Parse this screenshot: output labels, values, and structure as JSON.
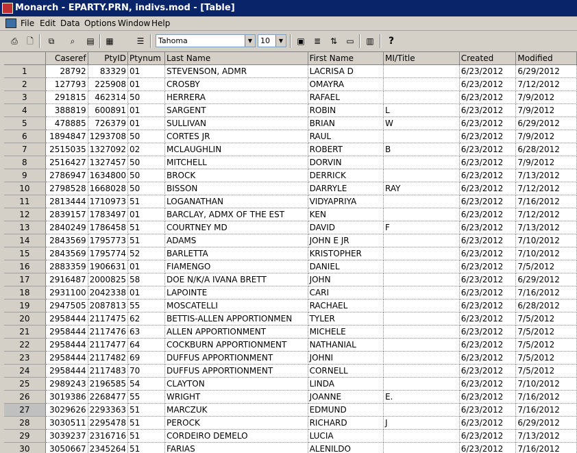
{
  "window": {
    "title": "Monarch - EPARTY.PRN, indivs.mod - [Table]"
  },
  "menu": [
    "File",
    "Edit",
    "Data",
    "Options",
    "Window",
    "Help"
  ],
  "toolbar": {
    "font": "Tahoma",
    "size": "10",
    "buttons_left": [
      {
        "name": "print-button",
        "glyph": "⎙"
      },
      {
        "name": "print-preview-button",
        "glyph": "🗋"
      },
      {
        "name": "copy-button",
        "glyph": "⧉"
      },
      {
        "name": "find-button",
        "glyph": "⌕"
      },
      {
        "name": "export-button",
        "glyph": "▤"
      },
      {
        "name": "grid-button",
        "glyph": "▦"
      },
      {
        "name": "sort-button",
        "glyph": "☰"
      }
    ],
    "buttons_right": [
      {
        "name": "calculator-button",
        "glyph": "▣"
      },
      {
        "name": "field-list-button",
        "glyph": "≣"
      },
      {
        "name": "sort-order-button",
        "glyph": "⇅"
      },
      {
        "name": "note-button",
        "glyph": "▭"
      },
      {
        "name": "summary-button",
        "glyph": "▥"
      },
      {
        "name": "help-button",
        "glyph": "?"
      }
    ]
  },
  "table": {
    "headers": [
      "",
      "Caseref",
      "PtyID",
      "Ptynum",
      "Last Name",
      "First Name",
      "MI/Title",
      "Created",
      "Modified"
    ],
    "rows": [
      [
        "1",
        "28792",
        "83329",
        "01",
        "STEVENSON, ADMR",
        "LACRISA D",
        "",
        "6/23/2012",
        "6/29/2012"
      ],
      [
        "2",
        "127793",
        "225908",
        "01",
        "CROSBY",
        "OMAYRA",
        "",
        "6/23/2012",
        "7/12/2012"
      ],
      [
        "3",
        "291815",
        "462314",
        "50",
        "HERRERA",
        "RAFAEL",
        "",
        "6/23/2012",
        "7/9/2012"
      ],
      [
        "4",
        "388819",
        "600891",
        "01",
        "SARGENT",
        "ROBIN",
        "L",
        "6/23/2012",
        "7/9/2012"
      ],
      [
        "5",
        "478885",
        "726379",
        "01",
        "SULLIVAN",
        "BRIAN",
        "W",
        "6/23/2012",
        "6/29/2012"
      ],
      [
        "6",
        "1894847",
        "1293708",
        "50",
        "CORTES JR",
        "RAUL",
        "",
        "6/23/2012",
        "7/9/2012"
      ],
      [
        "7",
        "2515035",
        "1327092",
        "02",
        "MCLAUGHLIN",
        "ROBERT",
        "B",
        "6/23/2012",
        "6/28/2012"
      ],
      [
        "8",
        "2516427",
        "1327457",
        "50",
        "MITCHELL",
        "DORVIN",
        "",
        "6/23/2012",
        "7/9/2012"
      ],
      [
        "9",
        "2786947",
        "1634800",
        "50",
        "BROCK",
        "DERRICK",
        "",
        "6/23/2012",
        "7/13/2012"
      ],
      [
        "10",
        "2798528",
        "1668028",
        "50",
        "BISSON",
        "DARRYLE",
        "RAY",
        "6/23/2012",
        "7/12/2012"
      ],
      [
        "11",
        "2813444",
        "1710973",
        "51",
        "LOGANATHAN",
        "VIDYAPRIYA",
        "",
        "6/23/2012",
        "7/16/2012"
      ],
      [
        "12",
        "2839157",
        "1783497",
        "01",
        "BARCLAY, ADMX OF THE EST",
        "KEN",
        "",
        "6/23/2012",
        "7/12/2012"
      ],
      [
        "13",
        "2840249",
        "1786458",
        "51",
        "COURTNEY MD",
        "DAVID",
        "F",
        "6/23/2012",
        "7/13/2012"
      ],
      [
        "14",
        "2843569",
        "1795773",
        "51",
        "ADAMS",
        "JOHN E JR",
        "",
        "6/23/2012",
        "7/10/2012"
      ],
      [
        "15",
        "2843569",
        "1795774",
        "52",
        "BARLETTA",
        "KRISTOPHER",
        "",
        "6/23/2012",
        "7/10/2012"
      ],
      [
        "16",
        "2883359",
        "1906631",
        "01",
        "FIAMENGO",
        "DANIEL",
        "",
        "6/23/2012",
        "7/5/2012"
      ],
      [
        "17",
        "2916487",
        "2000825",
        "58",
        "DOE N/K/A IVANA BRETT",
        "JOHN",
        "",
        "6/23/2012",
        "6/29/2012"
      ],
      [
        "18",
        "2931100",
        "2042338",
        "01",
        "LAPOINTE",
        "CARI",
        "",
        "6/23/2012",
        "7/16/2012"
      ],
      [
        "19",
        "2947505",
        "2087813",
        "55",
        "MOSCATELLI",
        "RACHAEL",
        "",
        "6/23/2012",
        "6/28/2012"
      ],
      [
        "20",
        "2958444",
        "2117475",
        "62",
        "BETTIS-ALLEN APPORTIONMEN",
        "TYLER",
        "",
        "6/23/2012",
        "7/5/2012"
      ],
      [
        "21",
        "2958444",
        "2117476",
        "63",
        "ALLEN APPORTIONMENT",
        "MICHELE",
        "",
        "6/23/2012",
        "7/5/2012"
      ],
      [
        "22",
        "2958444",
        "2117477",
        "64",
        "COCKBURN APPORTIONMENT",
        "NATHANIAL",
        "",
        "6/23/2012",
        "7/5/2012"
      ],
      [
        "23",
        "2958444",
        "2117482",
        "69",
        "DUFFUS APPORTIONMENT",
        "JOHNI",
        "",
        "6/23/2012",
        "7/5/2012"
      ],
      [
        "24",
        "2958444",
        "2117483",
        "70",
        "DUFFUS APPORTIONMENT",
        "CORNELL",
        "",
        "6/23/2012",
        "7/5/2012"
      ],
      [
        "25",
        "2989243",
        "2196585",
        "54",
        "CLAYTON",
        "LINDA",
        "",
        "6/23/2012",
        "7/10/2012"
      ],
      [
        "26",
        "3019386",
        "2268477",
        "55",
        "WRIGHT",
        "JOANNE",
        "E.",
        "6/23/2012",
        "7/16/2012"
      ],
      [
        "27",
        "3029626",
        "2293363",
        "51",
        "MARCZUK",
        "EDMUND",
        "",
        "6/23/2012",
        "7/16/2012"
      ],
      [
        "28",
        "3030511",
        "2295478",
        "51",
        "PEROCK",
        "RICHARD",
        "J",
        "6/23/2012",
        "6/29/2012"
      ],
      [
        "29",
        "3039237",
        "2316716",
        "51",
        "CORDEIRO DEMELO",
        "LUCIA",
        "",
        "6/23/2012",
        "7/13/2012"
      ],
      [
        "30",
        "3050667",
        "2345264",
        "51",
        "FARIAS",
        "ALENILDO",
        "",
        "6/23/2012",
        "7/16/2012"
      ]
    ]
  }
}
